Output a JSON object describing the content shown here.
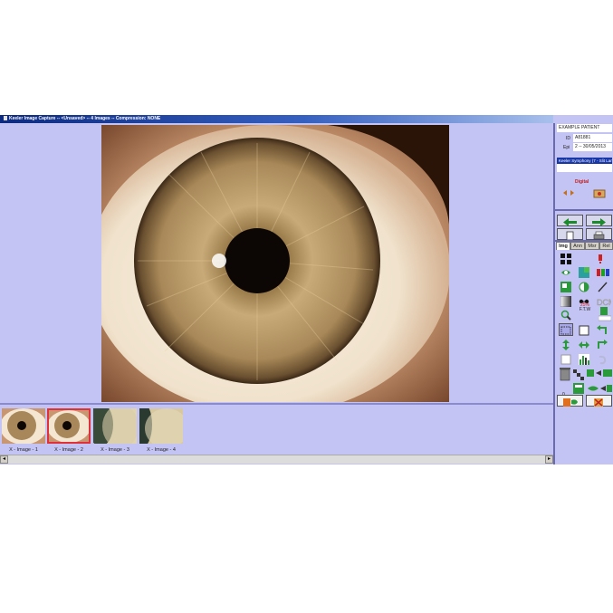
{
  "window": {
    "title": "Keeler Image Capture -- <Unsaved> -- 4 Images -- Compression: NONE"
  },
  "thumbnails": [
    {
      "label": "X - Image - 1",
      "selected": false
    },
    {
      "label": "X - Image - 2",
      "selected": true
    },
    {
      "label": "X - Image - 3",
      "selected": false
    },
    {
      "label": "X - Image - 4",
      "selected": false
    }
  ],
  "patient": {
    "name": "EXAMPLE PATIENT",
    "id_label": "ID",
    "id_value": "A81881",
    "epi_label": "Epi",
    "epi_value": "2 -- 30/05/2013"
  },
  "device": {
    "name": "Keeler Symphony (7 - Slit Lam",
    "mode": "Digital"
  },
  "tabs": [
    "Img",
    "Ann",
    "Msr",
    "Rel"
  ],
  "active_tab": "Img",
  "tools": {
    "ftw_percent": "25%",
    "ftw_label": "F.T.W",
    "counter": "0"
  },
  "colors": {
    "background": "#c4c4f4",
    "titlebar": "#0c2a80",
    "selection": "#e0303a",
    "accent_green": "#2a9a3a"
  }
}
